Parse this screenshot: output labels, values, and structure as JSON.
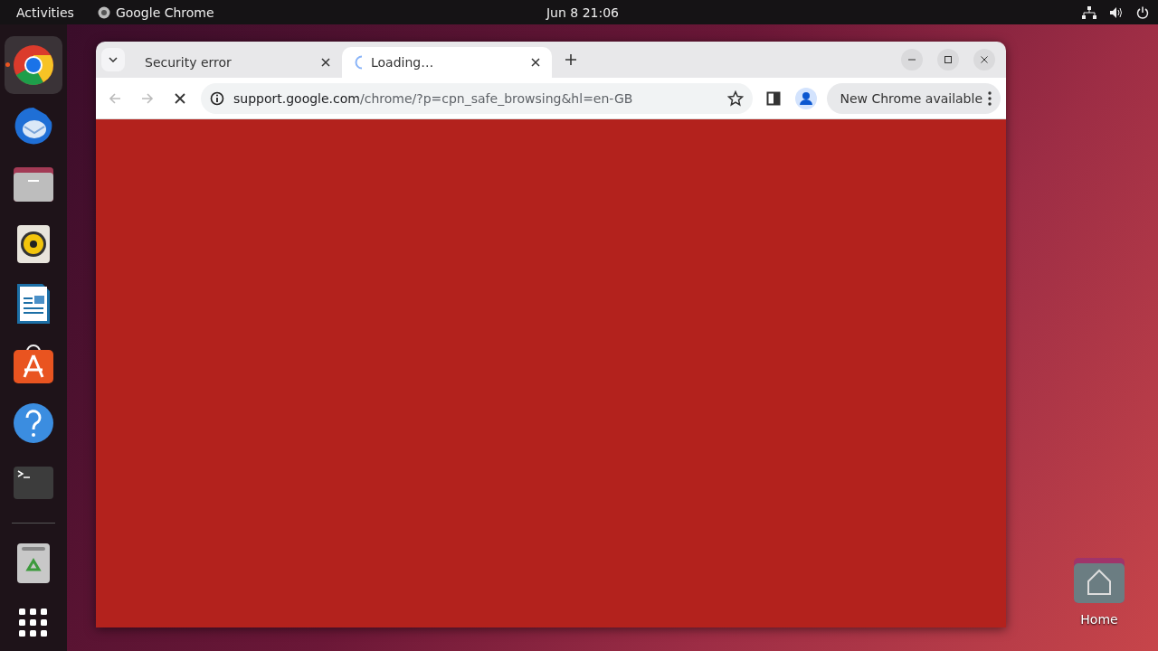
{
  "top_bar": {
    "activities": "Activities",
    "app_name": "Google Chrome",
    "clock": "Jun 8  21:06"
  },
  "dock": [
    {
      "kind": "chrome",
      "running": true
    },
    {
      "kind": "mail",
      "running": false
    },
    {
      "kind": "files",
      "running": false
    },
    {
      "kind": "music",
      "running": false
    },
    {
      "kind": "writer",
      "running": false
    },
    {
      "kind": "store",
      "running": false
    },
    {
      "kind": "help",
      "running": false
    },
    {
      "kind": "terminal",
      "running": false
    },
    {
      "kind": "trash",
      "running": false
    },
    {
      "kind": "apps",
      "running": false
    }
  ],
  "browser": {
    "tabs": [
      {
        "title": "Security error",
        "selected": false,
        "loading": false
      },
      {
        "title": "Loading…",
        "selected": true,
        "loading": true
      }
    ],
    "address": {
      "domain": "support.google.com",
      "path": "/chrome/?p=cpn_safe_browsing&hl=en-GB"
    },
    "update_button": "New Chrome available"
  },
  "desktop_icons": [
    {
      "label": "Home"
    }
  ]
}
